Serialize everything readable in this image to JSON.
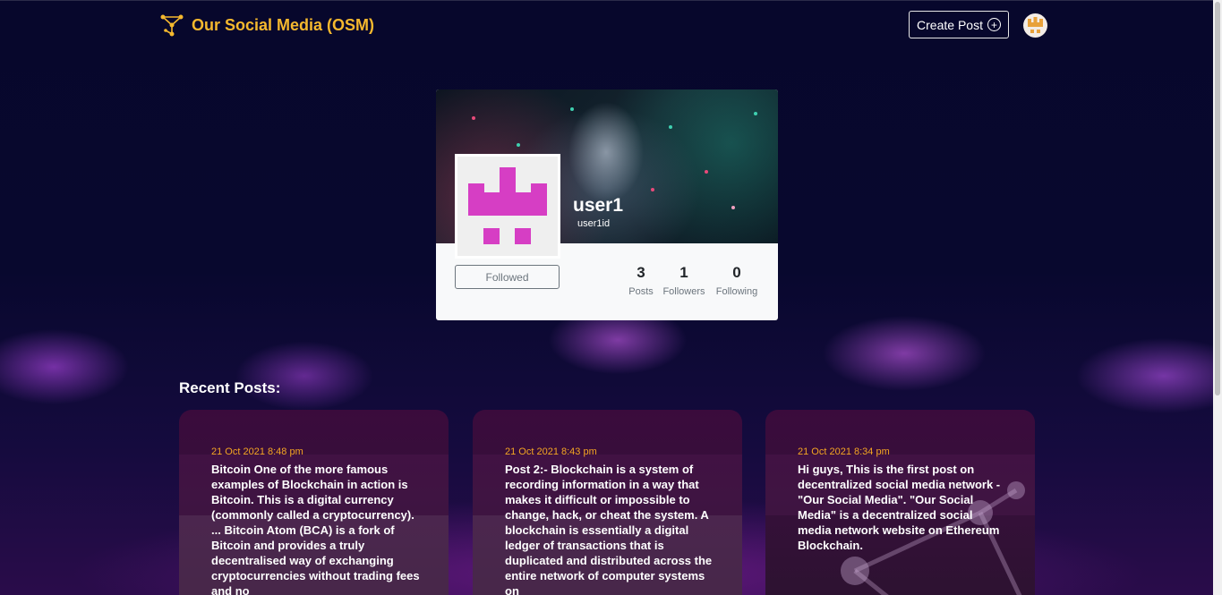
{
  "header": {
    "brand_title": "Our Social Media (OSM)",
    "create_post_label": "Create Post"
  },
  "profile": {
    "username": "user1",
    "userid": "user1id",
    "follow_button_label": "Followed",
    "stats": [
      {
        "value": "3",
        "label": "Posts"
      },
      {
        "value": "1",
        "label": "Followers"
      },
      {
        "value": "0",
        "label": "Following"
      }
    ]
  },
  "recent_posts": {
    "title": "Recent Posts:",
    "posts": [
      {
        "date": "21 Oct 2021 8:48 pm",
        "text": "Bitcoin One of the more famous examples of Blockchain in action is Bitcoin. This is a digital currency (commonly called a cryptocurrency). ... Bitcoin Atom (BCA) is a fork of Bitcoin and provides a truly decentralised way of exchanging cryptocurrencies without trading fees and no"
      },
      {
        "date": "21 Oct 2021 8:43 pm",
        "text": "Post 2:- Blockchain is a system of recording information in a way that makes it difficult or impossible to change, hack, or cheat the system. A blockchain is essentially a digital ledger of transactions that is duplicated and distributed across the entire network of computer systems on"
      },
      {
        "date": "21 Oct 2021 8:34 pm",
        "text": "Hi guys, This is the first post on decentralized social media network - \"Our Social Media\". \"Our Social Media\" is a decentralized social media network website on Ethereum Blockchain."
      }
    ]
  },
  "colors": {
    "brand": "#f5b82e",
    "date": "#f5a623",
    "avatar_magenta": "#d63ec4"
  }
}
